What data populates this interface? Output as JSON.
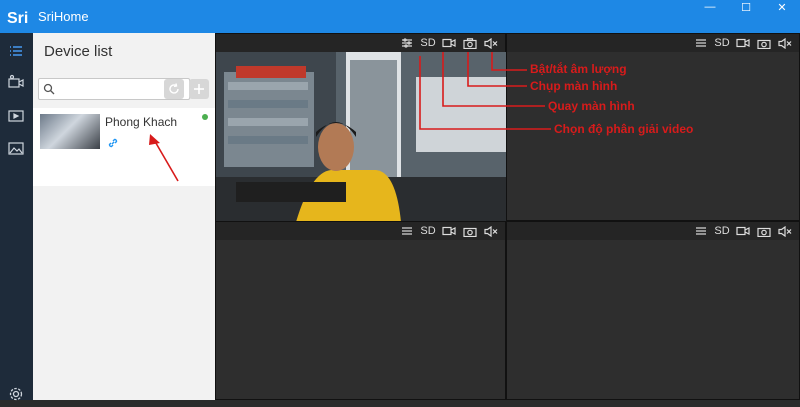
{
  "app": {
    "title": "SriHome",
    "logo_text": "Sri"
  },
  "window_controls": [
    "—",
    "☐",
    "✕"
  ],
  "sidebar": {
    "items": [
      {
        "name": "list-icon"
      },
      {
        "name": "camera-add-icon"
      },
      {
        "name": "video-playback-icon"
      },
      {
        "name": "image-gallery-icon"
      },
      {
        "name": "settings-icon"
      }
    ]
  },
  "device_panel": {
    "title": "Device list",
    "search_placeholder": "",
    "devices": [
      {
        "name": "Phong Khach",
        "online": true
      }
    ]
  },
  "cells": [
    {
      "resolution": "SD"
    },
    {
      "resolution": "SD"
    },
    {
      "resolution": "SD"
    },
    {
      "resolution": "SD"
    }
  ],
  "annotations": {
    "volume": "Bật/tắt âm lượng",
    "snapshot": "Chụp màn hình",
    "record": "Quay màn hình",
    "resolution": "Chọn độ phân giải video"
  },
  "colors": {
    "titlebar": "#1e88e5",
    "annotation": "#d81b1b",
    "online": "#4caf50"
  }
}
